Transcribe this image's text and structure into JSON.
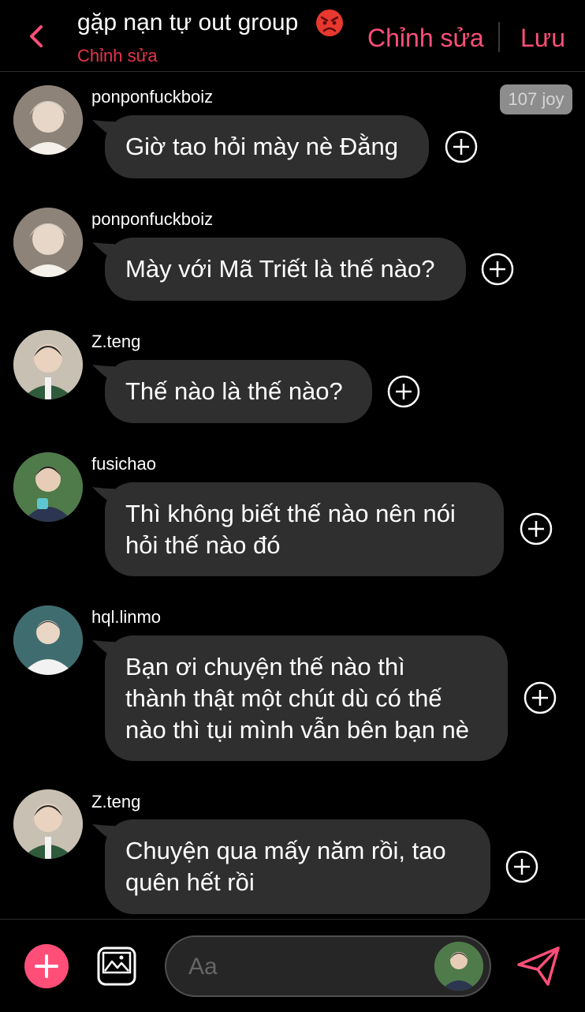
{
  "header": {
    "title": "gặp nạn tự out group",
    "title_emoji": "angry-face-icon",
    "subtitle": "Chỉnh sửa",
    "edit_label": "Chỉnh sửa",
    "save_label": "Lưu",
    "accent_color": "#ff4f78"
  },
  "badge": "107 joy",
  "messages": [
    {
      "user": "ponponfuckboiz",
      "text_lines": [
        "Giờ tao hỏi mày nè Đằng"
      ]
    },
    {
      "user": "ponponfuckboiz",
      "text_lines": [
        "Mày với Mã Triết là thế nào?"
      ]
    },
    {
      "user": "Z.teng",
      "text_lines": [
        "Thế nào là thế nào?"
      ]
    },
    {
      "user": "fusichao",
      "text_lines": [
        "Thì không biết thế nào nên nói",
        "hỏi thế nào đó"
      ]
    },
    {
      "user": "hql.linmo",
      "text_lines": [
        "Bạn ơi chuyện thế nào thì",
        "thành thật một chút dù có thế",
        "nào thì tụi mình vẫn bên bạn nè"
      ]
    },
    {
      "user": "Z.teng",
      "text_lines": [
        "Chuyện qua mấy năm rồi, tao",
        "quên hết rồi"
      ]
    }
  ],
  "composer": {
    "placeholder": "Aa",
    "icons": [
      "plus-icon",
      "gallery-icon",
      "send-icon"
    ]
  }
}
